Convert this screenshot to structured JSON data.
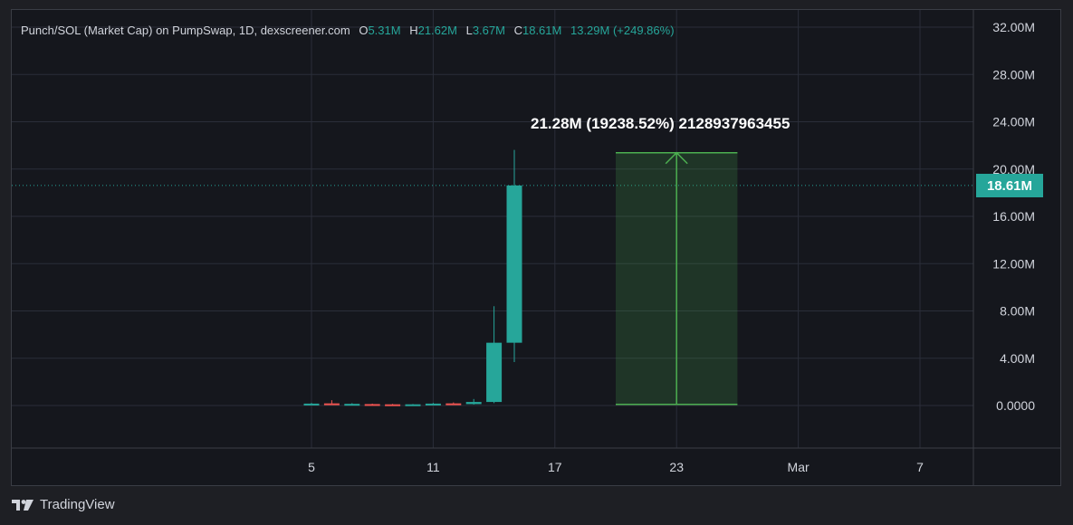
{
  "legend": {
    "symbol": "Punch/SOL (Market Cap) on PumpSwap, 1D, dexscreener.com",
    "open_label": "O",
    "open": "5.31M",
    "high_label": "H",
    "high": "21.62M",
    "low_label": "L",
    "low": "3.67M",
    "close_label": "C",
    "close": "18.61M",
    "change": "13.29M (+249.86%)"
  },
  "price_tag": "18.61M",
  "measure_label": "21.28M (19238.52%) 2128937963455",
  "branding": "TradingView",
  "colors": {
    "up": "#26a69a",
    "down": "#ef5350",
    "measure": "#4caf50",
    "background": "#15171d",
    "grid": "#2a2e39"
  },
  "chart_data": {
    "type": "candlestick",
    "y_ticks": [
      "32.00M",
      "28.00M",
      "24.00M",
      "20.00M",
      "16.00M",
      "12.00M",
      "8.00M",
      "4.00M",
      "0.0000"
    ],
    "ylim": [
      0,
      32000000
    ],
    "x_ticks": [
      {
        "label": "5",
        "day": 5
      },
      {
        "label": "11",
        "day": 11
      },
      {
        "label": "17",
        "day": 17
      },
      {
        "label": "23",
        "day": 23
      },
      {
        "label": "Mar",
        "day": 29
      },
      {
        "label": "7",
        "day": 35
      }
    ],
    "candles": [
      {
        "day": 5,
        "open": 0.12,
        "high": 0.22,
        "low": 0.06,
        "close": 0.16
      },
      {
        "day": 6,
        "open": 0.18,
        "high": 0.45,
        "low": 0.05,
        "close": 0.08
      },
      {
        "day": 7,
        "open": 0.08,
        "high": 0.2,
        "low": 0.04,
        "close": 0.14
      },
      {
        "day": 8,
        "open": 0.12,
        "high": 0.16,
        "low": 0.06,
        "close": 0.09
      },
      {
        "day": 9,
        "open": 0.1,
        "high": 0.14,
        "low": 0.04,
        "close": 0.06
      },
      {
        "day": 10,
        "open": 0.06,
        "high": 0.12,
        "low": 0.03,
        "close": 0.1
      },
      {
        "day": 11,
        "open": 0.1,
        "high": 0.22,
        "low": 0.06,
        "close": 0.16
      },
      {
        "day": 12,
        "open": 0.18,
        "high": 0.26,
        "low": 0.08,
        "close": 0.12
      },
      {
        "day": 13,
        "open": 0.12,
        "high": 0.55,
        "low": 0.08,
        "close": 0.3
      },
      {
        "day": 14,
        "open": 0.3,
        "high": 8.4,
        "low": 0.2,
        "close": 5.31
      },
      {
        "day": 15,
        "open": 5.31,
        "high": 21.62,
        "low": 3.67,
        "close": 18.61
      }
    ],
    "last_price": 18.61,
    "measure": {
      "start_day": 20,
      "end_day": 26,
      "from": 0.1,
      "to": 21.38
    }
  }
}
